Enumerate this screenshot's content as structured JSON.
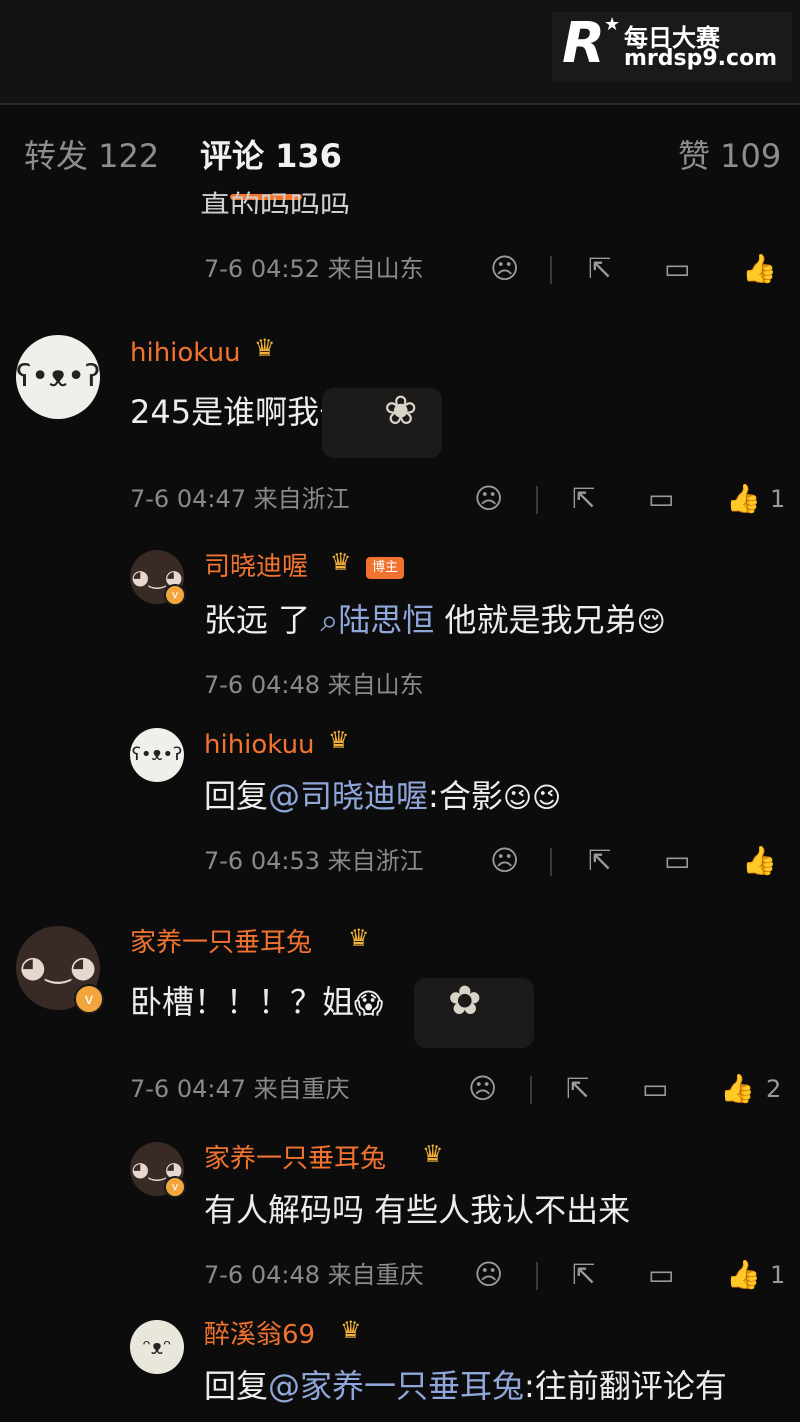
{
  "watermark": {
    "logo": "R",
    "brand": "每日大赛",
    "url": "mrdsp9.com"
  },
  "tabs": [
    {
      "label": "转发 122"
    },
    {
      "label": "评论 136"
    },
    {
      "label": "赞 109"
    }
  ],
  "cut_text": "真的吗吗吗",
  "comments": [
    {
      "meta": "7-6 04:52 来自山东"
    },
    {
      "username": "hihiokuu",
      "text": "245是谁啊我去",
      "meta": "7-6 04:47 来自浙江",
      "likes": "1",
      "replies": [
        {
          "username": "司晓迪喔",
          "owner_tag": "博主",
          "text_before": "张远 了",
          "mention": "陆思恒",
          "text_after": " 他就是我兄弟",
          "meta": "7-6 04:48 来自山东"
        },
        {
          "username": "hihiokuu",
          "text_prefix": "回复",
          "mention": "@司晓迪喔",
          "text_after": ":合影",
          "meta": "7-6 04:53 来自浙江"
        }
      ]
    },
    {
      "username": "家养一只垂耳兔",
      "text": "卧槽！！！？姐",
      "meta": "7-6 04:47 来自重庆",
      "likes": "2",
      "replies": [
        {
          "username": "家养一只垂耳兔",
          "text": "有人解码吗 有些人我认不出来",
          "meta": "7-6 04:48 来自重庆",
          "likes": "1"
        },
        {
          "username": "醉溪翁69",
          "text_prefix": "回复",
          "mention": "@家养一只垂耳兔",
          "text_after": ":往前翻评论有"
        }
      ]
    }
  ],
  "icons": {
    "dislike": "frown-face-icon",
    "share": "share-icon",
    "comment": "comment-bubble-icon",
    "like": "thumbs-up-icon",
    "crown": "crown-icon"
  },
  "colors": {
    "accent": "#f2732f",
    "mention": "#8fa6d9",
    "background": "#0c0c0d"
  }
}
